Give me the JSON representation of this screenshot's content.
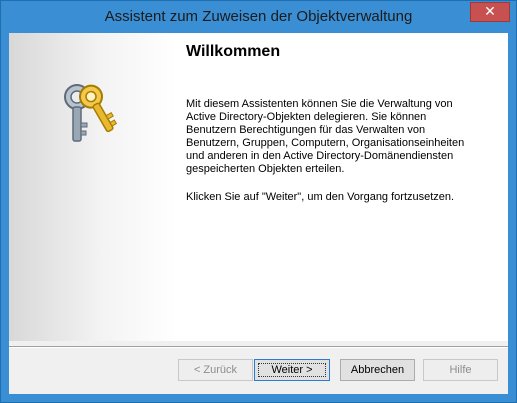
{
  "window": {
    "title": "Assistent zum Zuweisen der Objektverwaltung",
    "close_label": "✕"
  },
  "side_panel": {
    "icon": "keys-icon"
  },
  "content": {
    "heading": "Willkommen",
    "intro": "Mit diesem Assistenten können Sie die Verwaltung von Active Directory-Objekten delegieren. Sie können Benutzern Berechtigungen für das Verwalten von Benutzern, Gruppen, Computern, Organisationseinheiten und anderen in den Active Directory-Domänendiensten gespeicherten Objekten erteilen.",
    "instruction": "Klicken Sie auf \"Weiter\", um den Vorgang fortzusetzen."
  },
  "buttons": {
    "back": "< Zurück",
    "next": "Weiter >",
    "cancel": "Abbrechen",
    "help": "Hilfe"
  },
  "colors": {
    "title_bar": "#3a8ed4",
    "close_button": "#c75050",
    "key_gold": "#e8b830",
    "key_silver": "#9aa7b4"
  }
}
